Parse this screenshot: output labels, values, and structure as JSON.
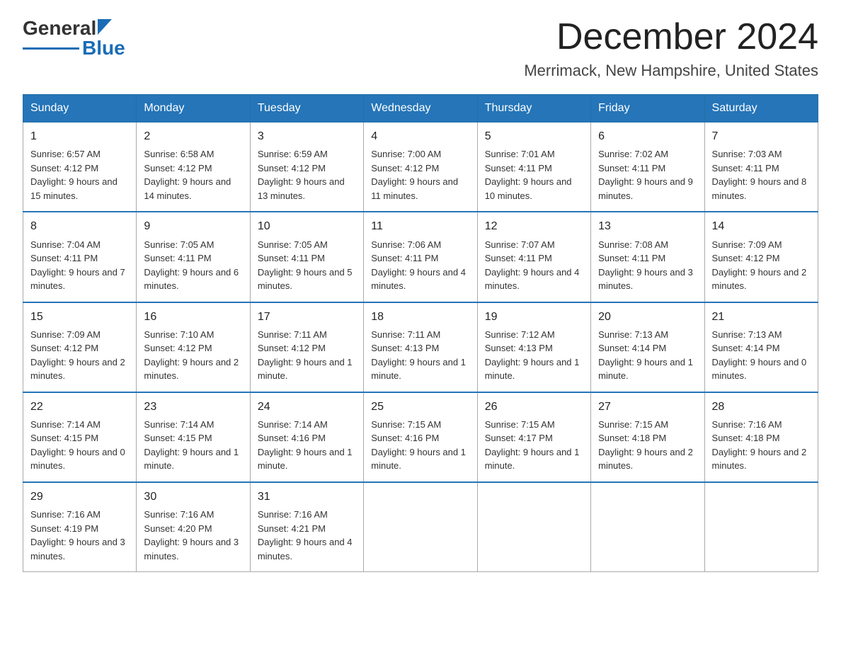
{
  "header": {
    "logo_general": "General",
    "logo_blue": "Blue",
    "month_title": "December 2024",
    "location": "Merrimack, New Hampshire, United States"
  },
  "weekdays": [
    "Sunday",
    "Monday",
    "Tuesday",
    "Wednesday",
    "Thursday",
    "Friday",
    "Saturday"
  ],
  "weeks": [
    [
      {
        "day": "1",
        "sunrise": "6:57 AM",
        "sunset": "4:12 PM",
        "daylight": "9 hours and 15 minutes."
      },
      {
        "day": "2",
        "sunrise": "6:58 AM",
        "sunset": "4:12 PM",
        "daylight": "9 hours and 14 minutes."
      },
      {
        "day": "3",
        "sunrise": "6:59 AM",
        "sunset": "4:12 PM",
        "daylight": "9 hours and 13 minutes."
      },
      {
        "day": "4",
        "sunrise": "7:00 AM",
        "sunset": "4:12 PM",
        "daylight": "9 hours and 11 minutes."
      },
      {
        "day": "5",
        "sunrise": "7:01 AM",
        "sunset": "4:11 PM",
        "daylight": "9 hours and 10 minutes."
      },
      {
        "day": "6",
        "sunrise": "7:02 AM",
        "sunset": "4:11 PM",
        "daylight": "9 hours and 9 minutes."
      },
      {
        "day": "7",
        "sunrise": "7:03 AM",
        "sunset": "4:11 PM",
        "daylight": "9 hours and 8 minutes."
      }
    ],
    [
      {
        "day": "8",
        "sunrise": "7:04 AM",
        "sunset": "4:11 PM",
        "daylight": "9 hours and 7 minutes."
      },
      {
        "day": "9",
        "sunrise": "7:05 AM",
        "sunset": "4:11 PM",
        "daylight": "9 hours and 6 minutes."
      },
      {
        "day": "10",
        "sunrise": "7:05 AM",
        "sunset": "4:11 PM",
        "daylight": "9 hours and 5 minutes."
      },
      {
        "day": "11",
        "sunrise": "7:06 AM",
        "sunset": "4:11 PM",
        "daylight": "9 hours and 4 minutes."
      },
      {
        "day": "12",
        "sunrise": "7:07 AM",
        "sunset": "4:11 PM",
        "daylight": "9 hours and 4 minutes."
      },
      {
        "day": "13",
        "sunrise": "7:08 AM",
        "sunset": "4:11 PM",
        "daylight": "9 hours and 3 minutes."
      },
      {
        "day": "14",
        "sunrise": "7:09 AM",
        "sunset": "4:12 PM",
        "daylight": "9 hours and 2 minutes."
      }
    ],
    [
      {
        "day": "15",
        "sunrise": "7:09 AM",
        "sunset": "4:12 PM",
        "daylight": "9 hours and 2 minutes."
      },
      {
        "day": "16",
        "sunrise": "7:10 AM",
        "sunset": "4:12 PM",
        "daylight": "9 hours and 2 minutes."
      },
      {
        "day": "17",
        "sunrise": "7:11 AM",
        "sunset": "4:12 PM",
        "daylight": "9 hours and 1 minute."
      },
      {
        "day": "18",
        "sunrise": "7:11 AM",
        "sunset": "4:13 PM",
        "daylight": "9 hours and 1 minute."
      },
      {
        "day": "19",
        "sunrise": "7:12 AM",
        "sunset": "4:13 PM",
        "daylight": "9 hours and 1 minute."
      },
      {
        "day": "20",
        "sunrise": "7:13 AM",
        "sunset": "4:14 PM",
        "daylight": "9 hours and 1 minute."
      },
      {
        "day": "21",
        "sunrise": "7:13 AM",
        "sunset": "4:14 PM",
        "daylight": "9 hours and 0 minutes."
      }
    ],
    [
      {
        "day": "22",
        "sunrise": "7:14 AM",
        "sunset": "4:15 PM",
        "daylight": "9 hours and 0 minutes."
      },
      {
        "day": "23",
        "sunrise": "7:14 AM",
        "sunset": "4:15 PM",
        "daylight": "9 hours and 1 minute."
      },
      {
        "day": "24",
        "sunrise": "7:14 AM",
        "sunset": "4:16 PM",
        "daylight": "9 hours and 1 minute."
      },
      {
        "day": "25",
        "sunrise": "7:15 AM",
        "sunset": "4:16 PM",
        "daylight": "9 hours and 1 minute."
      },
      {
        "day": "26",
        "sunrise": "7:15 AM",
        "sunset": "4:17 PM",
        "daylight": "9 hours and 1 minute."
      },
      {
        "day": "27",
        "sunrise": "7:15 AM",
        "sunset": "4:18 PM",
        "daylight": "9 hours and 2 minutes."
      },
      {
        "day": "28",
        "sunrise": "7:16 AM",
        "sunset": "4:18 PM",
        "daylight": "9 hours and 2 minutes."
      }
    ],
    [
      {
        "day": "29",
        "sunrise": "7:16 AM",
        "sunset": "4:19 PM",
        "daylight": "9 hours and 3 minutes."
      },
      {
        "day": "30",
        "sunrise": "7:16 AM",
        "sunset": "4:20 PM",
        "daylight": "9 hours and 3 minutes."
      },
      {
        "day": "31",
        "sunrise": "7:16 AM",
        "sunset": "4:21 PM",
        "daylight": "9 hours and 4 minutes."
      },
      null,
      null,
      null,
      null
    ]
  ]
}
